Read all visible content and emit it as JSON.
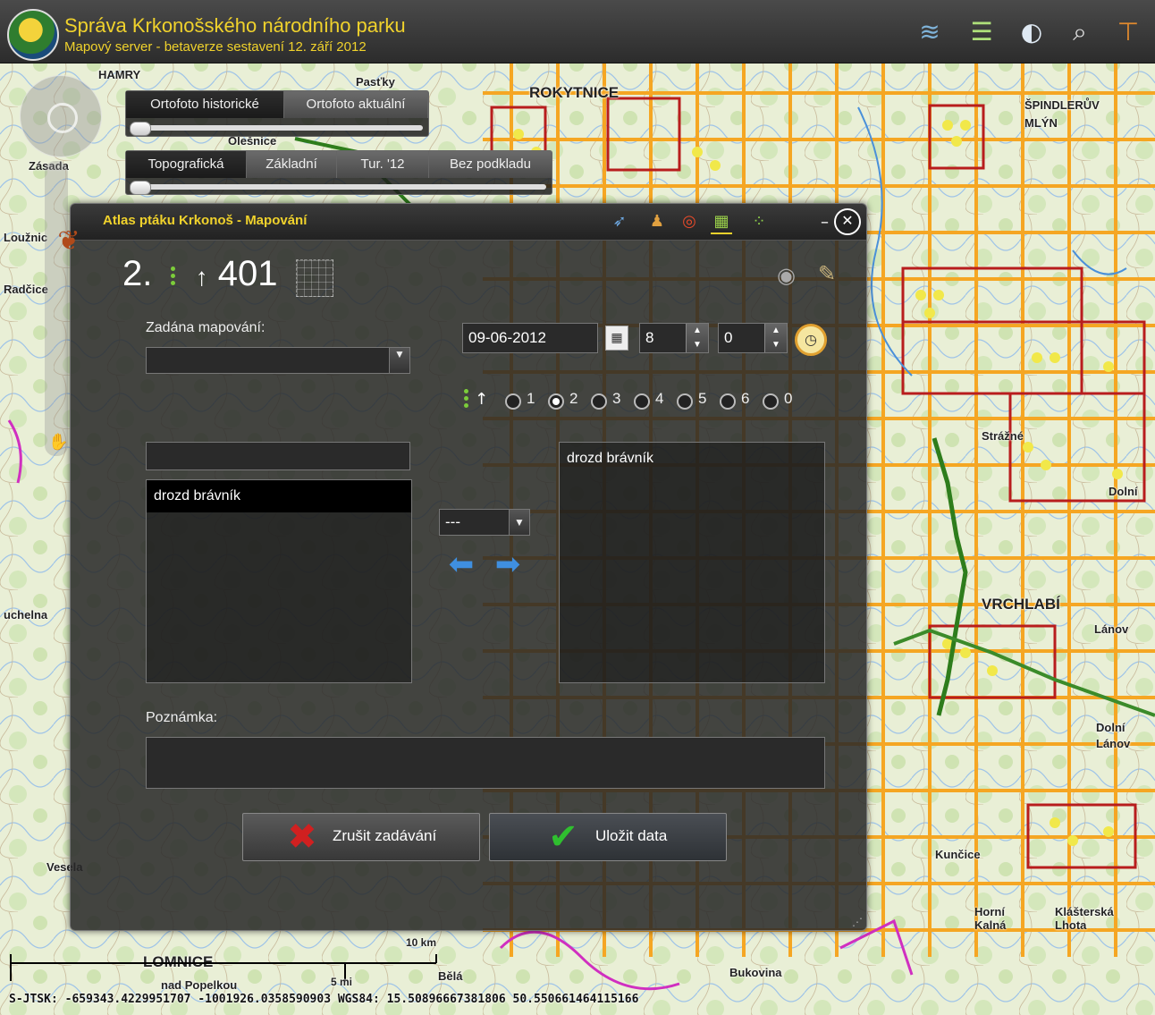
{
  "header": {
    "title": "Správa Krkonošského národního parku",
    "subtitle": "Mapový server - betaverze sestavení 12. září 2012",
    "icons": [
      "layers-icon",
      "legend-icon",
      "globe-icon",
      "search-icon",
      "signpost-icon"
    ]
  },
  "layers": {
    "ortho_tabs": [
      "Ortofoto historické",
      "Ortofoto aktuální"
    ],
    "base_tabs": [
      "Topografická",
      "Základní",
      "Tur. '12",
      "Bez podkladu"
    ],
    "active_ortho": 0,
    "active_base": 0
  },
  "map_labels": [
    {
      "id": "hamry",
      "text": "HAMRY"
    },
    {
      "id": "pasky",
      "text": "Pasťky"
    },
    {
      "id": "rokytnice",
      "text": "ROKYTNICE"
    },
    {
      "id": "spindleruv",
      "text": "ŠPINDLERŮV"
    },
    {
      "id": "mlyn",
      "text": "MLÝN"
    },
    {
      "id": "zasada",
      "text": "Zásada"
    },
    {
      "id": "olesnice",
      "text": "Olešnice"
    },
    {
      "id": "louznice",
      "text": "Loužnic"
    },
    {
      "id": "radcice",
      "text": "Radčice"
    },
    {
      "id": "strazne",
      "text": "Strážné"
    },
    {
      "id": "dolni",
      "text": "Dolní"
    },
    {
      "id": "vrchlabi",
      "text": "VRCHLABÍ"
    },
    {
      "id": "larov",
      "text": "Lánov"
    },
    {
      "id": "jolni",
      "text": "Dolní"
    },
    {
      "id": "lanov2",
      "text": "Lánov"
    },
    {
      "id": "uchelna",
      "text": "uchelna"
    },
    {
      "id": "vesela",
      "text": "Vesela"
    },
    {
      "id": "kunice",
      "text": "Kunčice"
    },
    {
      "id": "horni_kalna",
      "text": "Horní Kalná"
    },
    {
      "id": "klasterska",
      "text": "Klášterská Lhota"
    },
    {
      "id": "bukovina",
      "text": "Bukovina"
    },
    {
      "id": "bela",
      "text": "Bělá"
    },
    {
      "id": "lomnice",
      "text": "LOMNICE"
    },
    {
      "id": "nad_popelkou",
      "text": "nad Popelkou"
    }
  ],
  "dialog": {
    "title": "Atlas ptáku Krkonoš - Mapování",
    "counter_left": "2.",
    "counter_arrow": "↑",
    "counter_right": "401",
    "assigned_label": "Zadána mapování:",
    "assigned_value": "",
    "date_value": "09-06-2012",
    "hour_value": "8",
    "minute_value": "0",
    "radio_options": [
      "1",
      "2",
      "3",
      "4",
      "5",
      "6",
      "0"
    ],
    "radio_selected": "2",
    "filter_value": "",
    "species_list": [
      "drozd brávník"
    ],
    "species_selected": "drozd brávník",
    "qty_select": "---",
    "selected_list": [
      "drozd brávník"
    ],
    "note_label": "Poznámka:",
    "note_value": "",
    "cancel_label": "Zrušit zadávání",
    "save_label": "Uložit data"
  },
  "scale": {
    "km_label": "10 km",
    "mi_label": "5 mi"
  },
  "coords": "S-JTSK: -659343.4229951707 -1001926.0358590903  WGS84: 15.50896667381806 50.550661464115166"
}
